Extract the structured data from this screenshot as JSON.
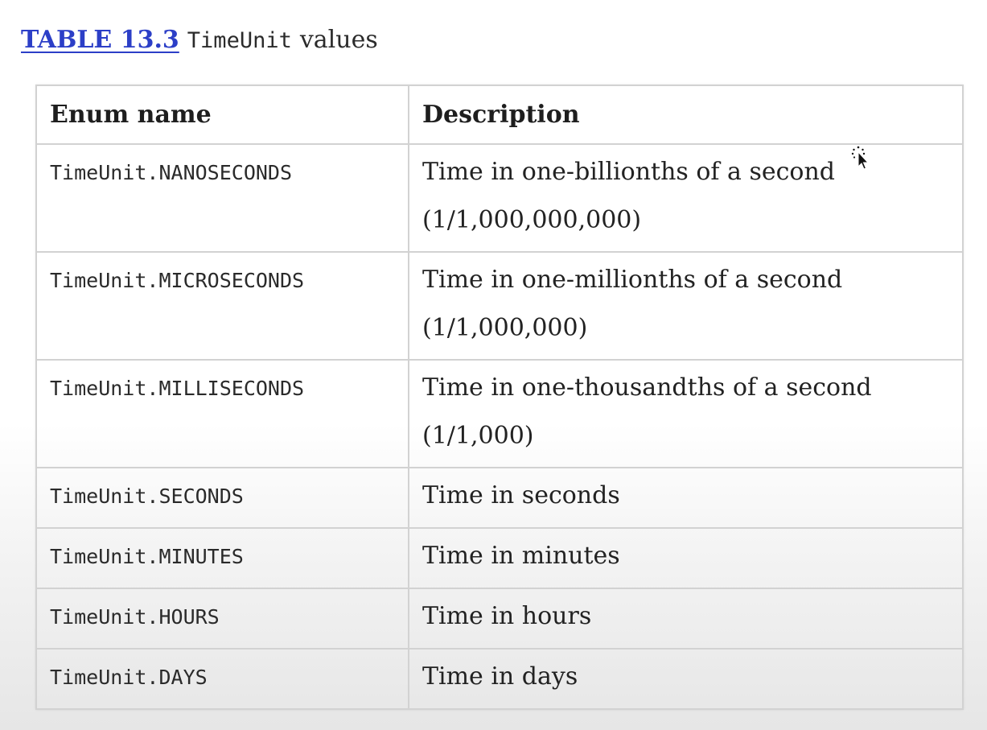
{
  "caption": {
    "link": "TABLE 13.3",
    "code": "TimeUnit",
    "text": "values"
  },
  "table": {
    "headers": [
      "Enum name",
      "Description"
    ],
    "rows": [
      {
        "name": "TimeUnit.NANOSECONDS",
        "desc_line1": "Time in one-billionths of a second",
        "desc_line2": "(1/1,000,000,000)"
      },
      {
        "name": "TimeUnit.MICROSECONDS",
        "desc_line1": "Time in one-millionths of a second",
        "desc_line2": "(1/1,000,000)"
      },
      {
        "name": "TimeUnit.MILLISECONDS",
        "desc_line1": "Time in one-thousandths of a second",
        "desc_line2": "(1/1,000)"
      },
      {
        "name": "TimeUnit.SECONDS",
        "desc_line1": "Time in seconds"
      },
      {
        "name": "TimeUnit.MINUTES",
        "desc_line1": "Time in minutes"
      },
      {
        "name": "TimeUnit.HOURS",
        "desc_line1": "Time in hours"
      },
      {
        "name": "TimeUnit.DAYS",
        "desc_line1": "Time in days"
      }
    ]
  },
  "colors": {
    "link": "#2c3fc7",
    "border": "#d2d2d2",
    "text": "#1d1d1d"
  },
  "cursor_icon": "busy-pointer-icon"
}
